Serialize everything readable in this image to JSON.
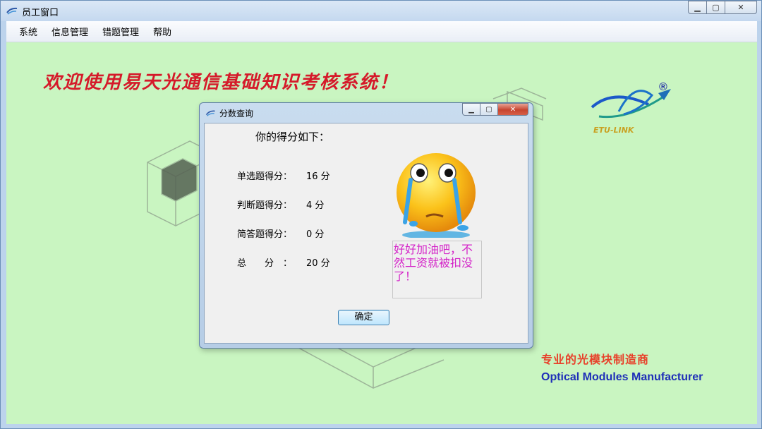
{
  "window": {
    "title": "员工窗口"
  },
  "menu": {
    "items": [
      "系统",
      "信息管理",
      "错题管理",
      "帮助"
    ]
  },
  "main": {
    "welcome": "欢迎使用易天光通信基础知识考核系统！",
    "logo_text": "ETU-LINK",
    "slogan_cn": "专业的光模块制造商",
    "slogan_en": "Optical Modules Manufacturer"
  },
  "dialog": {
    "title": "分数查询",
    "header": "你的得分如下：",
    "scores": [
      {
        "label": "单选题得分：",
        "value": "16 分"
      },
      {
        "label": "判断题得分：",
        "value": "4 分"
      },
      {
        "label": "简答题得分：",
        "value": "0 分"
      },
      {
        "label": "总　　分　：",
        "value": "20 分"
      }
    ],
    "message": "好好加油吧，不然工资就被扣没了！",
    "ok_label": "确定"
  },
  "colors": {
    "background": "#c9f5c1",
    "welcome": "#d51a2a",
    "message": "#d423c8",
    "slogan_en": "#1f2fb8"
  },
  "icons": [
    "app-icon",
    "minimize-icon",
    "maximize-icon",
    "close-icon",
    "crying-face-icon",
    "company-logo"
  ]
}
